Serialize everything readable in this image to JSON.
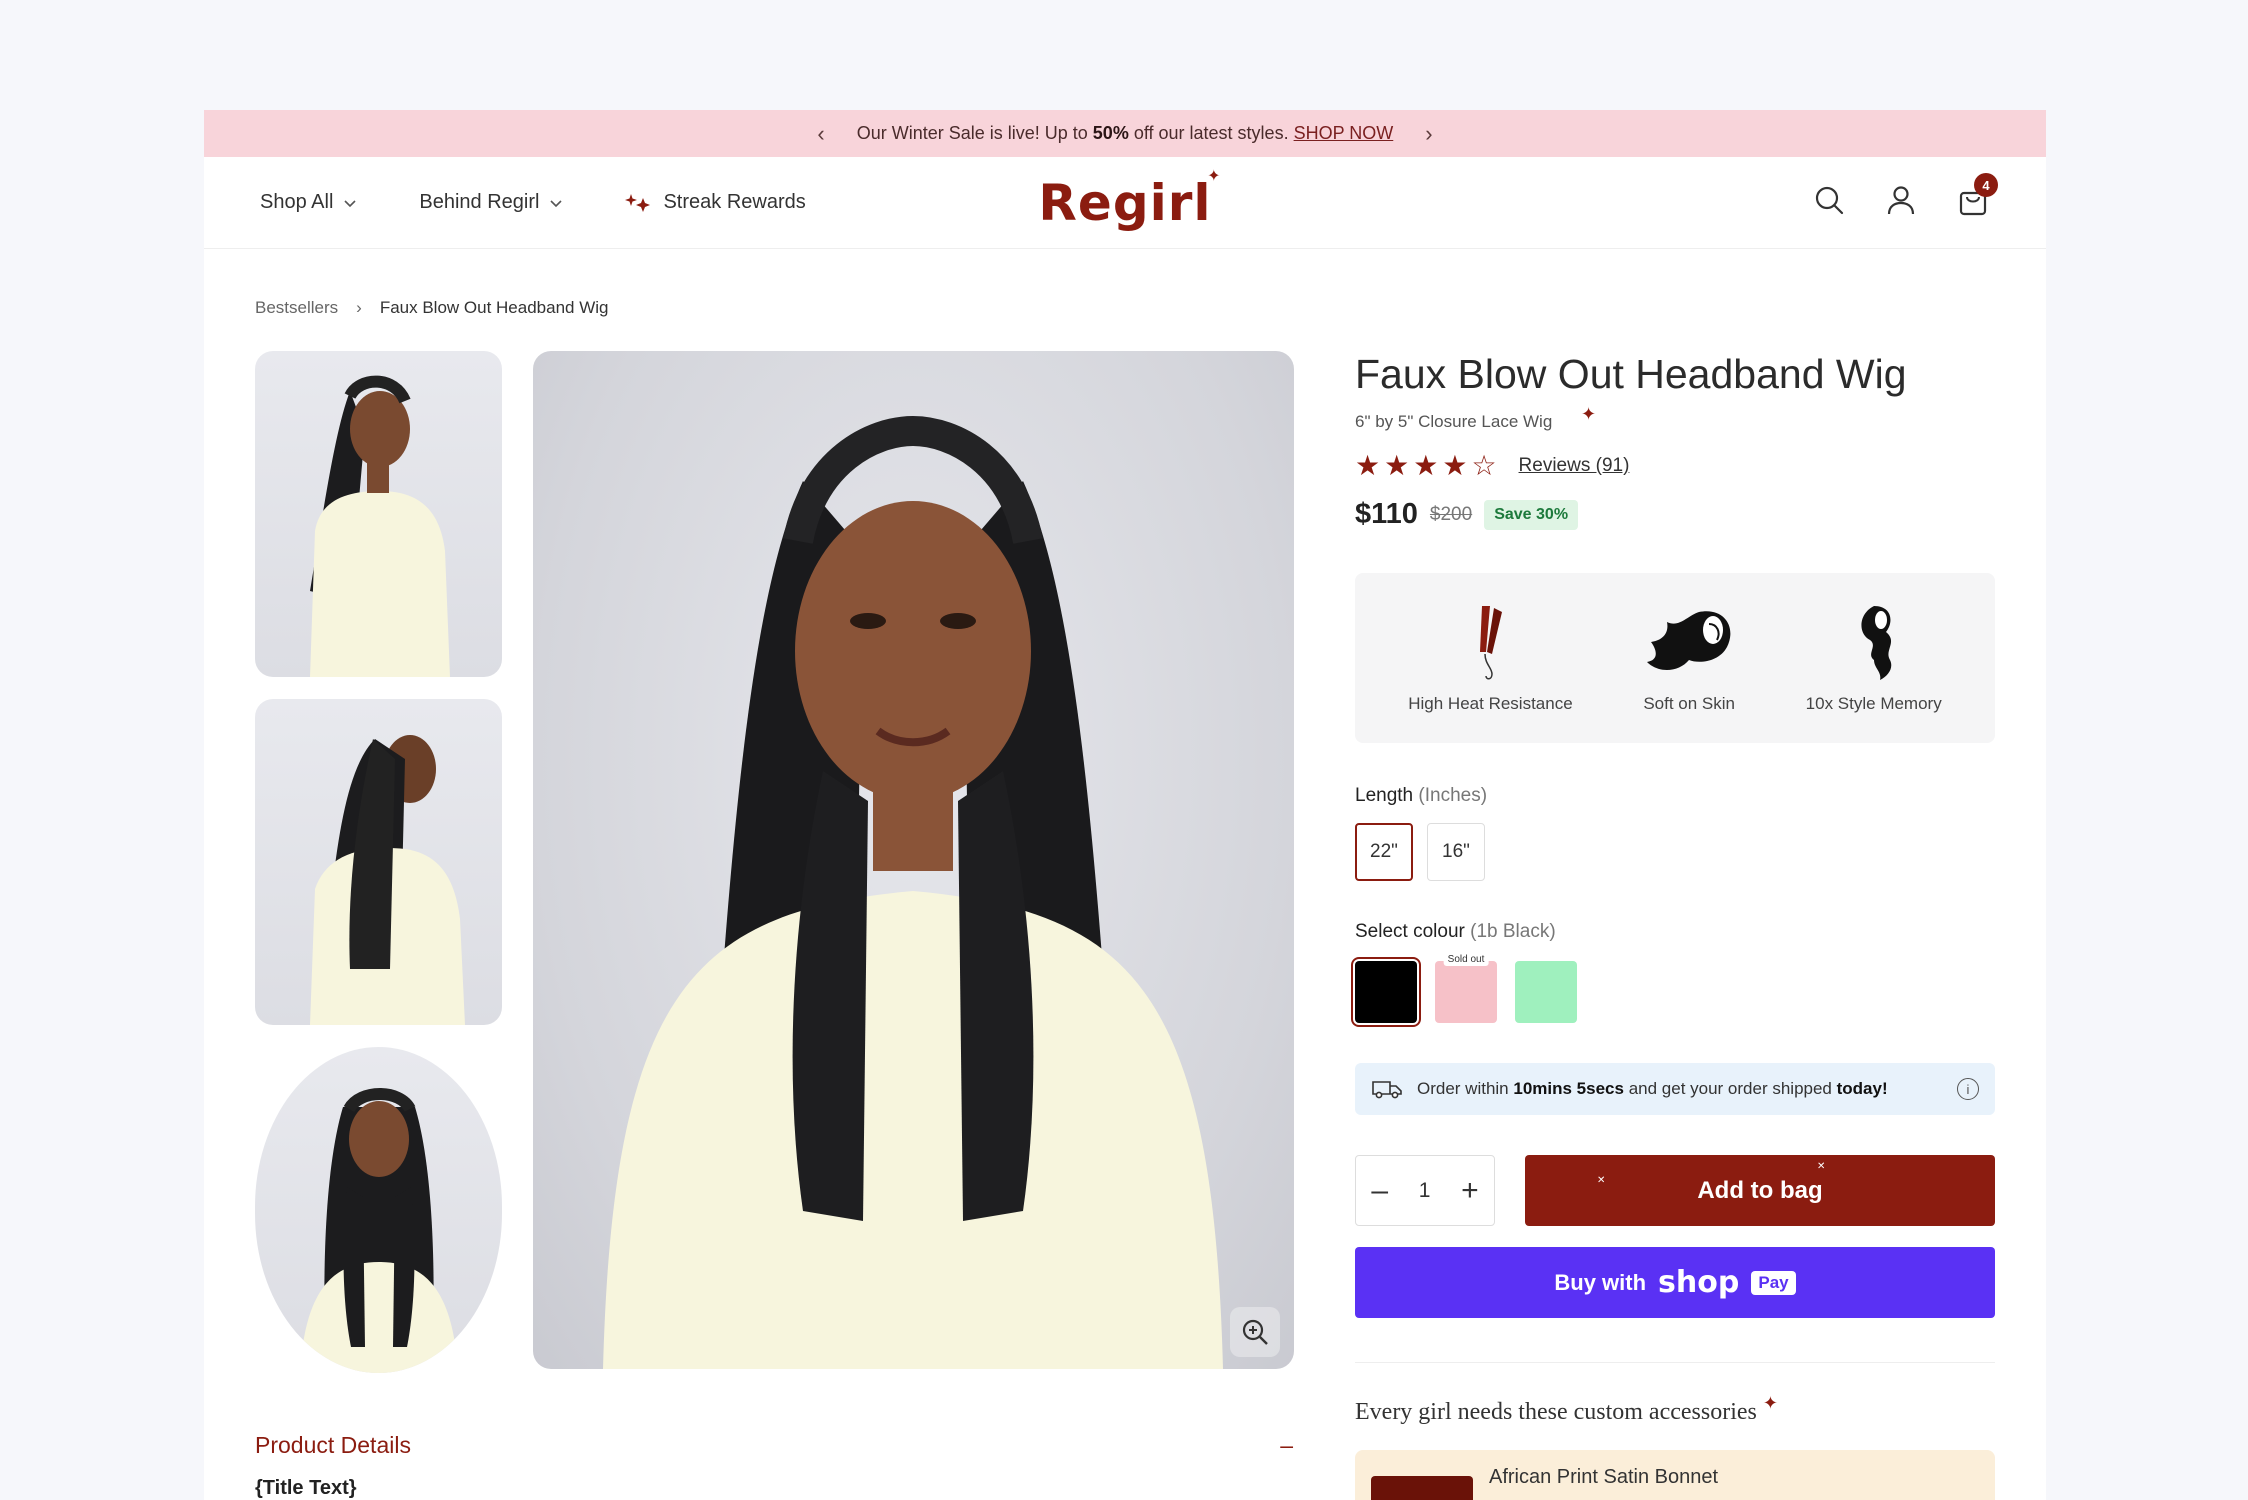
{
  "announcement": {
    "text_pre": "Our Winter Sale is live! Up to ",
    "text_bold": "50%",
    "text_post": " off our latest styles. ",
    "link": "SHOP NOW",
    "prev": "‹",
    "next": "›"
  },
  "header": {
    "nav": [
      {
        "label": "Shop All",
        "icon": "chevron-down-icon"
      },
      {
        "label": "Behind Regirl",
        "icon": "chevron-down-icon"
      },
      {
        "label": "Streak Rewards",
        "icon": "sparkle-icon"
      }
    ],
    "logo": "Regirl",
    "cart_count": "4",
    "icons": [
      "search-icon",
      "account-icon",
      "bag-icon"
    ]
  },
  "breadcrumb": {
    "parent": "Bestsellers",
    "separator": "›",
    "current": "Faux Blow Out Headband Wig"
  },
  "gallery": {
    "thumbnails": 3,
    "zoom_icon": "zoom-in-icon"
  },
  "product": {
    "title": "Faux Blow Out Headband Wig",
    "subtitle": "6\" by 5\" Closure Lace Wig",
    "rating": 4,
    "rating_max": 5,
    "reviews_label": "Reviews (91)",
    "price": "$110",
    "old_price": "$200",
    "save_label": "Save 30%",
    "features": [
      {
        "label": "High Heat Resistance",
        "icon": "flat-iron-icon"
      },
      {
        "label": "Soft on Skin",
        "icon": "flowing-hair-icon"
      },
      {
        "label": "10x Style Memory",
        "icon": "wavy-hair-icon"
      }
    ],
    "length": {
      "label": "Length",
      "unit": "(Inches)",
      "options": [
        "22\"",
        "16\""
      ],
      "selected": "22\""
    },
    "colour": {
      "label": "Select colour",
      "selected_name": "(1b Black)",
      "swatches": [
        {
          "color": "#000000",
          "selected": true,
          "sold_out": false
        },
        {
          "color": "#f6c1c8",
          "selected": false,
          "sold_out": true
        },
        {
          "color": "#9ff0be",
          "selected": false,
          "sold_out": false
        }
      ],
      "sold_out_label": "Sold out"
    },
    "shipping": {
      "pre": "Order within ",
      "time": "10mins 5secs",
      "mid": " and get your order shipped ",
      "day": "today!"
    },
    "quantity": "1",
    "add_to_bag": "Add to bag",
    "buy_with": "Buy with",
    "shop_brand": "shop",
    "pay_label": "Pay"
  },
  "accessories": {
    "title": "Every girl needs these custom accessories",
    "items": [
      {
        "name": "African Print Satin Bonnet"
      }
    ]
  },
  "details": {
    "title": "Product Details",
    "toggle": "–",
    "sub": "{Title Text}"
  },
  "colors": {
    "brand": "#8b1c10",
    "announce_bg": "#f8d4da",
    "shoppay": "#5a31f4"
  }
}
